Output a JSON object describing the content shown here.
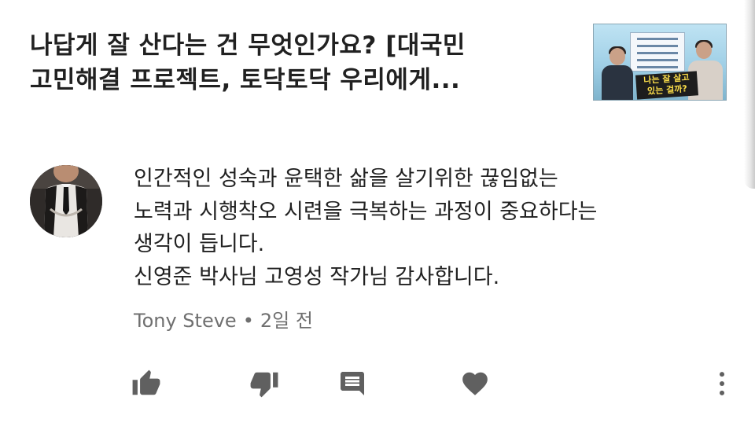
{
  "video": {
    "title_line1": "나답게 잘 산다는 건 무엇인가요? [대국민",
    "title_line2": "고민해결 프로젝트, 토닥토닥 우리에게...",
    "thumbnail": {
      "caption_line1": "나는 잘 살고",
      "caption_line2": "있는 걸까?"
    }
  },
  "comment": {
    "lines": [
      "인간적인 성숙과 윤택한 삶을 살기위한 끊임없는",
      "노력과 시행착오 시련을 극복하는 과정이 중요하다는",
      "생각이 듭니다.",
      "신영준 박사님 고영성 작가님 감사합니다."
    ],
    "author": "Tony Steve",
    "separator": "•",
    "time": "2일 전"
  },
  "actions": {
    "like_icon": "thumb-up-icon",
    "dislike_icon": "thumb-down-icon",
    "reply_icon": "comment-icon",
    "heart_icon": "heart-icon",
    "more_icon": "more-vert-icon",
    "icon_color": "#606060"
  },
  "colors": {
    "title_text": "#212121",
    "body_text": "#212121",
    "meta_text": "#6f6f6f",
    "background": "#ffffff"
  }
}
